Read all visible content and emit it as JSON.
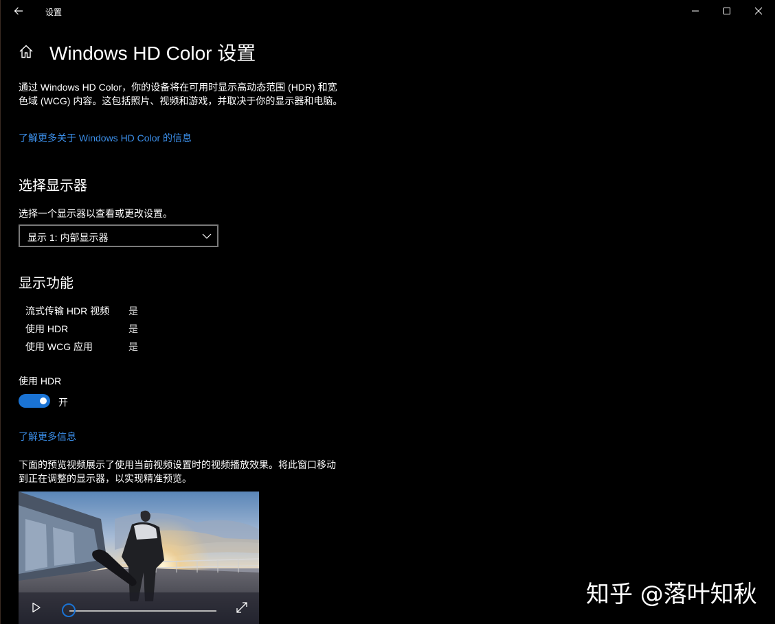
{
  "window": {
    "title": "设置"
  },
  "header": {
    "page_title": "Windows HD Color 设置"
  },
  "intro": {
    "description": "通过 Windows HD Color，你的设备将在可用时显示高动态范围 (HDR) 和宽色域 (WCG) 内容。这包括照片、视频和游戏，并取决于你的显示器和电脑。",
    "learn_link": "了解更多关于 Windows HD Color 的信息"
  },
  "display_select": {
    "heading": "选择显示器",
    "label": "选择一个显示器以查看或更改设置。",
    "selected": "显示 1: 内部显示器"
  },
  "features": {
    "heading": "显示功能",
    "rows": [
      {
        "name": "流式传输 HDR 视频",
        "value": "是"
      },
      {
        "name": "使用 HDR",
        "value": "是"
      },
      {
        "name": "使用 WCG 应用",
        "value": "是"
      }
    ]
  },
  "hdr_toggle": {
    "label": "使用 HDR",
    "state_text": "开",
    "on": true
  },
  "more_info_link": "了解更多信息",
  "preview": {
    "description": "下面的预览视频展示了使用当前视频设置时的视频播放效果。将此窗口移动到正在调整的显示器，以实现精准预览。",
    "progress": 0.0
  },
  "watermark": "知乎 @落叶知秋",
  "colors": {
    "accent": "#1a73d4",
    "link": "#3b8ee8",
    "background": "#000000"
  }
}
